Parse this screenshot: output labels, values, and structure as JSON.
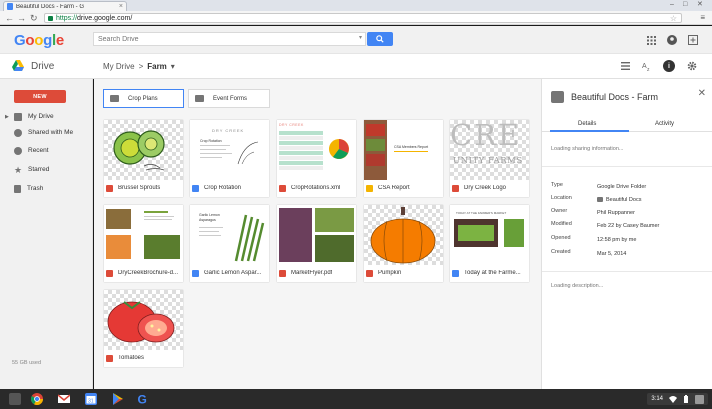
{
  "browser": {
    "tab_title": "Beautiful Docs - Farm - G",
    "tab_close": "×",
    "url_scheme": "https://",
    "url_host": "drive.google.com",
    "url_path": "/",
    "back": "←",
    "forward": "→",
    "reload": "↻",
    "menu": "≡",
    "minimize": "–",
    "maximize": "□",
    "close": "✕"
  },
  "header": {
    "logo_letters": [
      {
        "char": "G",
        "color": "#4285f4"
      },
      {
        "char": "o",
        "color": "#ea4335"
      },
      {
        "char": "o",
        "color": "#fbbc05"
      },
      {
        "char": "g",
        "color": "#4285f4"
      },
      {
        "char": "l",
        "color": "#34a853"
      },
      {
        "char": "e",
        "color": "#ea4335"
      }
    ],
    "search_placeholder": "Search Drive",
    "icons": [
      "apps-icon",
      "account-icon",
      "add-account-icon"
    ]
  },
  "drive_bar": {
    "title": "Drive",
    "breadcrumb": {
      "root": "My Drive",
      "separator": ">",
      "current": "Farm",
      "dropdown": "▾"
    },
    "toolbar_icons": [
      "list-view-icon",
      "sort-icon",
      "info-icon",
      "settings-icon"
    ],
    "info_glyph": "i"
  },
  "sidebar": {
    "new_label": "NEW",
    "items": [
      {
        "label": "My Drive",
        "icon": "my-drive-icon",
        "caret": "▶"
      },
      {
        "label": "Shared with Me",
        "icon": "shared-icon",
        "caret": ""
      },
      {
        "label": "Recent",
        "icon": "recent-icon",
        "caret": ""
      },
      {
        "label": "Starred",
        "icon": "star-icon",
        "caret": ""
      },
      {
        "label": "Trash",
        "icon": "trash-icon",
        "caret": ""
      }
    ],
    "storage": "55 GB used"
  },
  "folders": [
    {
      "name": "Crop Plans",
      "selected": true
    },
    {
      "name": "Event Forms",
      "selected": false
    }
  ],
  "files": [
    {
      "name": "Brussel Sprouts",
      "type": "image"
    },
    {
      "name": "Crop Rotation",
      "type": "doc"
    },
    {
      "name": "CropRotations.xml",
      "type": "pdf"
    },
    {
      "name": "CSA Report",
      "type": "slides"
    },
    {
      "name": "Dry Creek Logo",
      "type": "image"
    },
    {
      "name": "DryCreekBrochure-d...",
      "type": "image"
    },
    {
      "name": "Garlic Lemon Aspar...",
      "type": "doc"
    },
    {
      "name": "MarketFlyer.pdf",
      "type": "pdf"
    },
    {
      "name": "Pumpkin",
      "type": "image"
    },
    {
      "name": "Today at the Farme...",
      "type": "doc"
    },
    {
      "name": "Tomatoes",
      "type": "image"
    }
  ],
  "thumb_text": {
    "dry_creek": "DRY CREEK",
    "crop_rotation": "Crop Rotation",
    "csa_report_title": "CSA Members Report",
    "logo_big": "CRE",
    "logo_small": "UNITY FARMS",
    "garlic_title": "Garlic Lemon Asparagus",
    "farmers_market": "TODAY AT THE FARMER'S MARKET"
  },
  "details": {
    "title": "Beautiful Docs - Farm",
    "close": "✕",
    "tabs": [
      "Details",
      "Activity"
    ],
    "loading_sharing": "Loading sharing information...",
    "properties": [
      {
        "key": "Type",
        "value": "Google Drive Folder"
      },
      {
        "key": "Location",
        "value": "Beautiful Docs"
      },
      {
        "key": "Owner",
        "value": "Phil Ruppanner"
      },
      {
        "key": "Modified",
        "value": "Feb 22 by Casey Baumer"
      },
      {
        "key": "Opened",
        "value": "12:58 pm by me"
      },
      {
        "key": "Created",
        "value": "Mar 5, 2014"
      }
    ],
    "loading_description": "Loading description..."
  },
  "shelf": {
    "apps": [
      "chrome-icon",
      "gmail-icon",
      "calendar-icon",
      "play-store-icon",
      "google-search-icon"
    ],
    "time": "3:14"
  }
}
